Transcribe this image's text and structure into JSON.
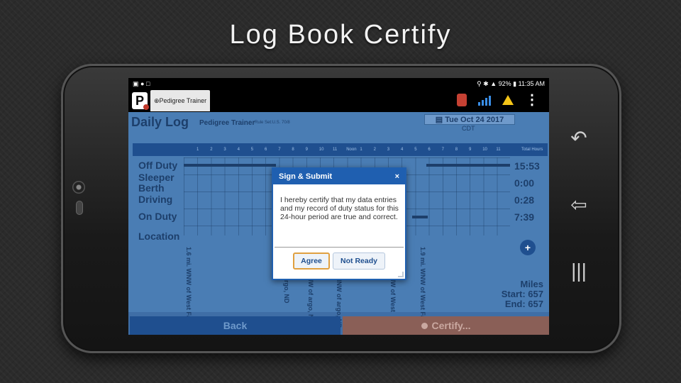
{
  "slide": {
    "title": "Log Book Certify"
  },
  "status_bar": {
    "time": "11:35 AM",
    "battery": "92%"
  },
  "app_bar": {
    "logo": "P",
    "tab_label": "⊕Pedigree Trainer"
  },
  "log": {
    "title": "Daily Log",
    "driver": "Pedigree Trainer",
    "rule": "Rule Set:U.S. 70/8",
    "date": "Tue Oct 24 2017",
    "timezone": "CDT",
    "hour_ticks": [
      "1",
      "2",
      "3",
      "4",
      "5",
      "6",
      "7",
      "8",
      "9",
      "10",
      "11",
      "Noon",
      "1",
      "2",
      "3",
      "4",
      "5",
      "6",
      "7",
      "8",
      "9",
      "10",
      "11"
    ],
    "total_hours_label": "Total Hours",
    "rows": [
      {
        "label": "Off Duty",
        "total": "15:53"
      },
      {
        "label": "Sleeper Berth",
        "total": "0:00"
      },
      {
        "label": "Driving",
        "total": "0:28"
      },
      {
        "label": "On Duty",
        "total": "7:39"
      }
    ],
    "location_label": "Location",
    "locations": [
      "1.6 mi. WNW of West Fargo, ND",
      "argo, ND",
      "NW of argo, ND",
      "NNW of argo, ND",
      "NW of West",
      "1.9 mi. WNW of West Fargo, ND"
    ],
    "add_button": "+",
    "miles": {
      "label": "Miles",
      "start": "Start: 657",
      "end": "End: 657"
    }
  },
  "footer": {
    "back": "Back",
    "certify": "Certify..."
  },
  "modal": {
    "title": "Sign & Submit",
    "close": "×",
    "body": "I hereby certify that my data entries and my record of duty status for this 24-hour period are true and correct.",
    "agree": "Agree",
    "not_ready": "Not Ready"
  },
  "colors": {
    "primary": "#1f5fb0",
    "accent": "#f5c518",
    "certify": "#8a5f57"
  }
}
